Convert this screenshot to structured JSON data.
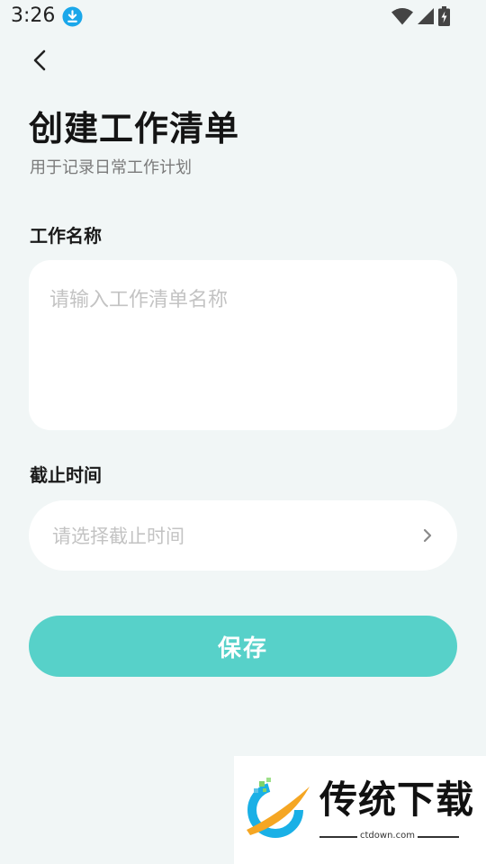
{
  "status_bar": {
    "time": "3:26",
    "icons": [
      "download-notification-icon",
      "wifi-icon",
      "signal-icon",
      "battery-charging-icon"
    ]
  },
  "header": {
    "back_icon": "chevron-left-icon",
    "title": "创建工作清单",
    "subtitle": "用于记录日常工作计划"
  },
  "form": {
    "name": {
      "label": "工作名称",
      "value": "",
      "placeholder": "请输入工作清单名称"
    },
    "deadline": {
      "label": "截止时间",
      "placeholder": "请选择截止时间",
      "icon": "chevron-right-icon"
    },
    "save_label": "保存"
  },
  "watermark": {
    "name": "传统下载",
    "url": "ctdown.com"
  },
  "colors": {
    "background": "#f1f6f6",
    "accent": "#57d1c9",
    "placeholder": "#c3c3c3",
    "download_badge": "#1aa7ea"
  }
}
